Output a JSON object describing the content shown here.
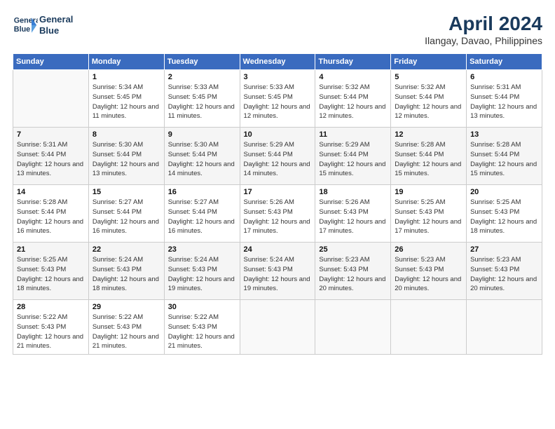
{
  "header": {
    "logo_line1": "General",
    "logo_line2": "Blue",
    "month_title": "April 2024",
    "location": "Ilangay, Davao, Philippines"
  },
  "weekdays": [
    "Sunday",
    "Monday",
    "Tuesday",
    "Wednesday",
    "Thursday",
    "Friday",
    "Saturday"
  ],
  "weeks": [
    [
      {
        "day": "",
        "info": ""
      },
      {
        "day": "1",
        "info": "Sunrise: 5:34 AM\nSunset: 5:45 PM\nDaylight: 12 hours\nand 11 minutes."
      },
      {
        "day": "2",
        "info": "Sunrise: 5:33 AM\nSunset: 5:45 PM\nDaylight: 12 hours\nand 11 minutes."
      },
      {
        "day": "3",
        "info": "Sunrise: 5:33 AM\nSunset: 5:45 PM\nDaylight: 12 hours\nand 12 minutes."
      },
      {
        "day": "4",
        "info": "Sunrise: 5:32 AM\nSunset: 5:44 PM\nDaylight: 12 hours\nand 12 minutes."
      },
      {
        "day": "5",
        "info": "Sunrise: 5:32 AM\nSunset: 5:44 PM\nDaylight: 12 hours\nand 12 minutes."
      },
      {
        "day": "6",
        "info": "Sunrise: 5:31 AM\nSunset: 5:44 PM\nDaylight: 12 hours\nand 13 minutes."
      }
    ],
    [
      {
        "day": "7",
        "info": "Sunrise: 5:31 AM\nSunset: 5:44 PM\nDaylight: 12 hours\nand 13 minutes."
      },
      {
        "day": "8",
        "info": "Sunrise: 5:30 AM\nSunset: 5:44 PM\nDaylight: 12 hours\nand 13 minutes."
      },
      {
        "day": "9",
        "info": "Sunrise: 5:30 AM\nSunset: 5:44 PM\nDaylight: 12 hours\nand 14 minutes."
      },
      {
        "day": "10",
        "info": "Sunrise: 5:29 AM\nSunset: 5:44 PM\nDaylight: 12 hours\nand 14 minutes."
      },
      {
        "day": "11",
        "info": "Sunrise: 5:29 AM\nSunset: 5:44 PM\nDaylight: 12 hours\nand 15 minutes."
      },
      {
        "day": "12",
        "info": "Sunrise: 5:28 AM\nSunset: 5:44 PM\nDaylight: 12 hours\nand 15 minutes."
      },
      {
        "day": "13",
        "info": "Sunrise: 5:28 AM\nSunset: 5:44 PM\nDaylight: 12 hours\nand 15 minutes."
      }
    ],
    [
      {
        "day": "14",
        "info": "Sunrise: 5:28 AM\nSunset: 5:44 PM\nDaylight: 12 hours\nand 16 minutes."
      },
      {
        "day": "15",
        "info": "Sunrise: 5:27 AM\nSunset: 5:44 PM\nDaylight: 12 hours\nand 16 minutes."
      },
      {
        "day": "16",
        "info": "Sunrise: 5:27 AM\nSunset: 5:44 PM\nDaylight: 12 hours\nand 16 minutes."
      },
      {
        "day": "17",
        "info": "Sunrise: 5:26 AM\nSunset: 5:43 PM\nDaylight: 12 hours\nand 17 minutes."
      },
      {
        "day": "18",
        "info": "Sunrise: 5:26 AM\nSunset: 5:43 PM\nDaylight: 12 hours\nand 17 minutes."
      },
      {
        "day": "19",
        "info": "Sunrise: 5:25 AM\nSunset: 5:43 PM\nDaylight: 12 hours\nand 17 minutes."
      },
      {
        "day": "20",
        "info": "Sunrise: 5:25 AM\nSunset: 5:43 PM\nDaylight: 12 hours\nand 18 minutes."
      }
    ],
    [
      {
        "day": "21",
        "info": "Sunrise: 5:25 AM\nSunset: 5:43 PM\nDaylight: 12 hours\nand 18 minutes."
      },
      {
        "day": "22",
        "info": "Sunrise: 5:24 AM\nSunset: 5:43 PM\nDaylight: 12 hours\nand 18 minutes."
      },
      {
        "day": "23",
        "info": "Sunrise: 5:24 AM\nSunset: 5:43 PM\nDaylight: 12 hours\nand 19 minutes."
      },
      {
        "day": "24",
        "info": "Sunrise: 5:24 AM\nSunset: 5:43 PM\nDaylight: 12 hours\nand 19 minutes."
      },
      {
        "day": "25",
        "info": "Sunrise: 5:23 AM\nSunset: 5:43 PM\nDaylight: 12 hours\nand 20 minutes."
      },
      {
        "day": "26",
        "info": "Sunrise: 5:23 AM\nSunset: 5:43 PM\nDaylight: 12 hours\nand 20 minutes."
      },
      {
        "day": "27",
        "info": "Sunrise: 5:23 AM\nSunset: 5:43 PM\nDaylight: 12 hours\nand 20 minutes."
      }
    ],
    [
      {
        "day": "28",
        "info": "Sunrise: 5:22 AM\nSunset: 5:43 PM\nDaylight: 12 hours\nand 21 minutes."
      },
      {
        "day": "29",
        "info": "Sunrise: 5:22 AM\nSunset: 5:43 PM\nDaylight: 12 hours\nand 21 minutes."
      },
      {
        "day": "30",
        "info": "Sunrise: 5:22 AM\nSunset: 5:43 PM\nDaylight: 12 hours\nand 21 minutes."
      },
      {
        "day": "",
        "info": ""
      },
      {
        "day": "",
        "info": ""
      },
      {
        "day": "",
        "info": ""
      },
      {
        "day": "",
        "info": ""
      }
    ]
  ]
}
